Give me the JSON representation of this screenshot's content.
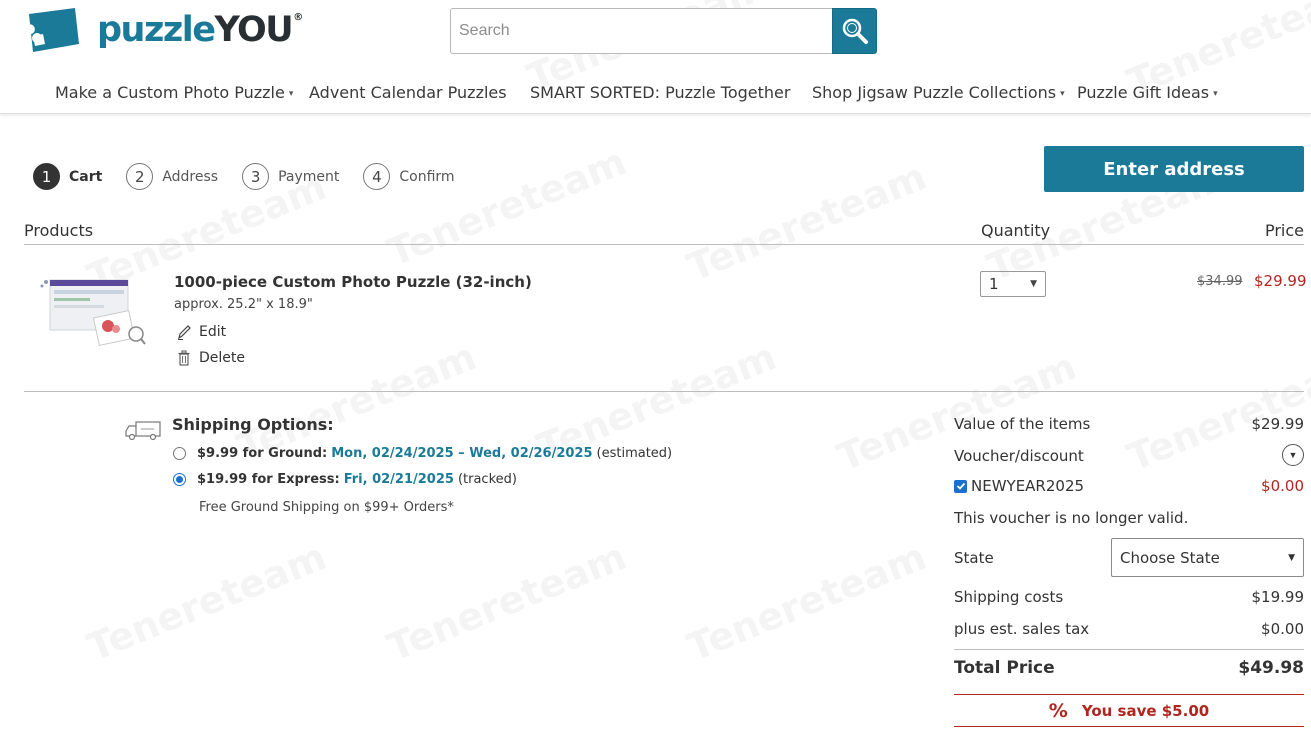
{
  "header": {
    "logo": {
      "part1": "puzzle",
      "part2": "YOU",
      "reg": "®"
    },
    "search": {
      "placeholder": "Search"
    }
  },
  "nav": [
    {
      "label": "Make a Custom Photo Puzzle",
      "dropdown": true
    },
    {
      "label": "Advent Calendar Puzzles",
      "dropdown": false
    },
    {
      "label": "SMART SORTED: Puzzle Together",
      "dropdown": false
    },
    {
      "label": "Shop Jigsaw Puzzle Collections",
      "dropdown": true
    },
    {
      "label": "Puzzle Gift Ideas",
      "dropdown": true
    }
  ],
  "steps": [
    {
      "num": "1",
      "label": "Cart",
      "active": true
    },
    {
      "num": "2",
      "label": "Address",
      "active": false
    },
    {
      "num": "3",
      "label": "Payment",
      "active": false
    },
    {
      "num": "4",
      "label": "Confirm",
      "active": false
    }
  ],
  "enter_address_label": "Enter address",
  "table": {
    "products": "Products",
    "quantity": "Quantity",
    "price": "Price"
  },
  "product": {
    "title": "1000-piece Custom Photo Puzzle (32-inch)",
    "size": "approx. 25.2\" x 18.9\"",
    "edit": "Edit",
    "delete": "Delete",
    "quantity": "1",
    "old_price": "$34.99",
    "new_price": "$29.99"
  },
  "shipping": {
    "title": "Shipping Options:",
    "options": [
      {
        "price": "$9.99 for Ground:",
        "date": "Mon, 02/24/2025 – Wed, 02/26/2025",
        "note": "(estimated)",
        "selected": false
      },
      {
        "price": "$19.99 for Express:",
        "date": "Fri, 02/21/2025",
        "note": "(tracked)",
        "selected": true
      }
    ],
    "free_note": "Free Ground Shipping on $99+ Orders*"
  },
  "summary": {
    "items_label": "Value of the items",
    "items_value": "$29.99",
    "voucher_label": "Voucher/discount",
    "voucher_code": "NEWYEAR2025",
    "voucher_value": "$0.00",
    "voucher_invalid": "This voucher is no longer valid.",
    "state_label": "State",
    "state_value": "Choose State",
    "shipping_label": "Shipping costs",
    "shipping_value": "$19.99",
    "tax_label": "plus est. sales tax",
    "tax_value": "$0.00",
    "total_label": "Total Price",
    "total_value": "$49.98",
    "save_label": "You save $5.00"
  },
  "watermark": "Tenereteam",
  "colors": {
    "brand": "#1b7a98",
    "sale": "#b1251e",
    "dark": "#2a2f33"
  }
}
